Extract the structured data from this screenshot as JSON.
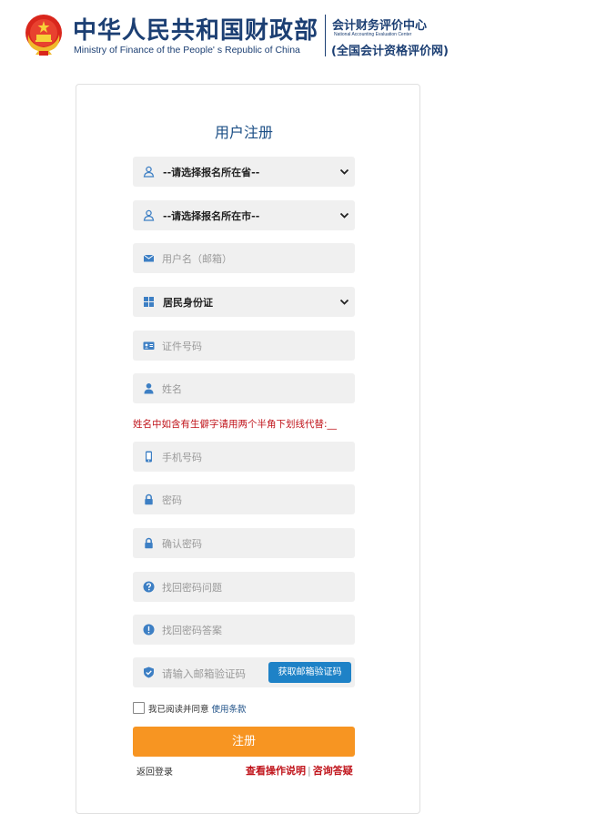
{
  "header": {
    "title_cn": "中华人民共和国财政部",
    "title_en": "Ministry of Finance of the People' s Republic of China",
    "org_cn": "会计财务评价中心",
    "org_en": "National Accounting Evaluation Center",
    "org_sub": "(全国会计资格评价网)"
  },
  "form": {
    "title": "用户注册",
    "province_select": "--请选择报名所在省--",
    "city_select": "--请选择报名所在市--",
    "username_placeholder": "用户名（邮箱）",
    "idtype_select": "居民身份证",
    "idnumber_placeholder": "证件号码",
    "name_placeholder": "姓名",
    "name_hint": "姓名中如含有生僻字请用两个半角下划线代替:__",
    "phone_placeholder": "手机号码",
    "password_placeholder": "密码",
    "confirm_password_placeholder": "确认密码",
    "question_placeholder": "找回密码问题",
    "answer_placeholder": "找回密码答案",
    "email_code_placeholder": "请输入邮箱验证码",
    "get_code_button": "获取邮箱验证码",
    "agree_prefix": "我已阅读并同意",
    "agree_link": "使用条款",
    "submit_button": "注册",
    "back_link": "返回登录",
    "help_link": "查看操作说明",
    "faq_link": "咨询答疑",
    "help_separator": "|"
  },
  "colors": {
    "brand_blue": "#1c3f73",
    "accent_orange": "#f79522",
    "warning_red": "#c0141b",
    "icon_blue": "#3d7fc4",
    "button_blue": "#1e82c7"
  },
  "icons": [
    "emblem-icon",
    "user-icon",
    "envelope-icon",
    "grid-icon",
    "id-card-icon",
    "person-icon",
    "phone-icon",
    "lock-icon",
    "question-icon",
    "exclamation-icon",
    "shield-icon",
    "chevron-down-icon"
  ]
}
